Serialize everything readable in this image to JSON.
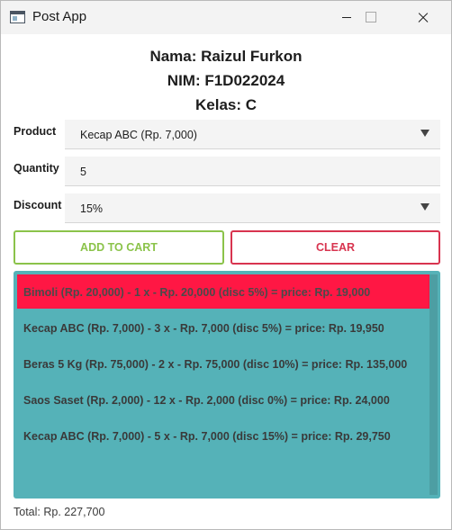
{
  "window": {
    "title": "Post App"
  },
  "header": {
    "name": "Nama: Raizul Furkon",
    "nim": "NIM: F1D022024",
    "kelas": "Kelas: C"
  },
  "form": {
    "product_label": "Product",
    "product_value": "Kecap ABC (Rp. 7,000)",
    "quantity_label": "Quantity",
    "quantity_value": "5",
    "discount_label": "Discount",
    "discount_value": "15%"
  },
  "buttons": {
    "add_to_cart": "ADD TO CART",
    "clear": "CLEAR"
  },
  "cart": {
    "items": [
      {
        "text": "Bimoli (Rp. 20,000) - 1 x - Rp. 20,000 (disc 5%) = price: Rp. 19,000"
      },
      {
        "text": "Kecap ABC (Rp. 7,000) - 3 x - Rp. 7,000 (disc 5%) = price: Rp. 19,950"
      },
      {
        "text": "Beras 5 Kg (Rp. 75,000) - 2 x - Rp. 75,000 (disc 10%) = price: Rp. 135,000"
      },
      {
        "text": "Saos Saset (Rp. 2,000) - 12 x - Rp. 2,000 (disc 0%) = price: Rp. 24,000"
      },
      {
        "text": "Kecap ABC (Rp. 7,000) - 5 x - Rp. 7,000 (disc 15%) = price: Rp. 29,750"
      }
    ]
  },
  "total": "Total: Rp. 227,700",
  "colors": {
    "accent_green": "#8bc34a",
    "accent_red": "#d8344f",
    "list_background": "#55b2b8",
    "selected_row": "#ff1744"
  }
}
